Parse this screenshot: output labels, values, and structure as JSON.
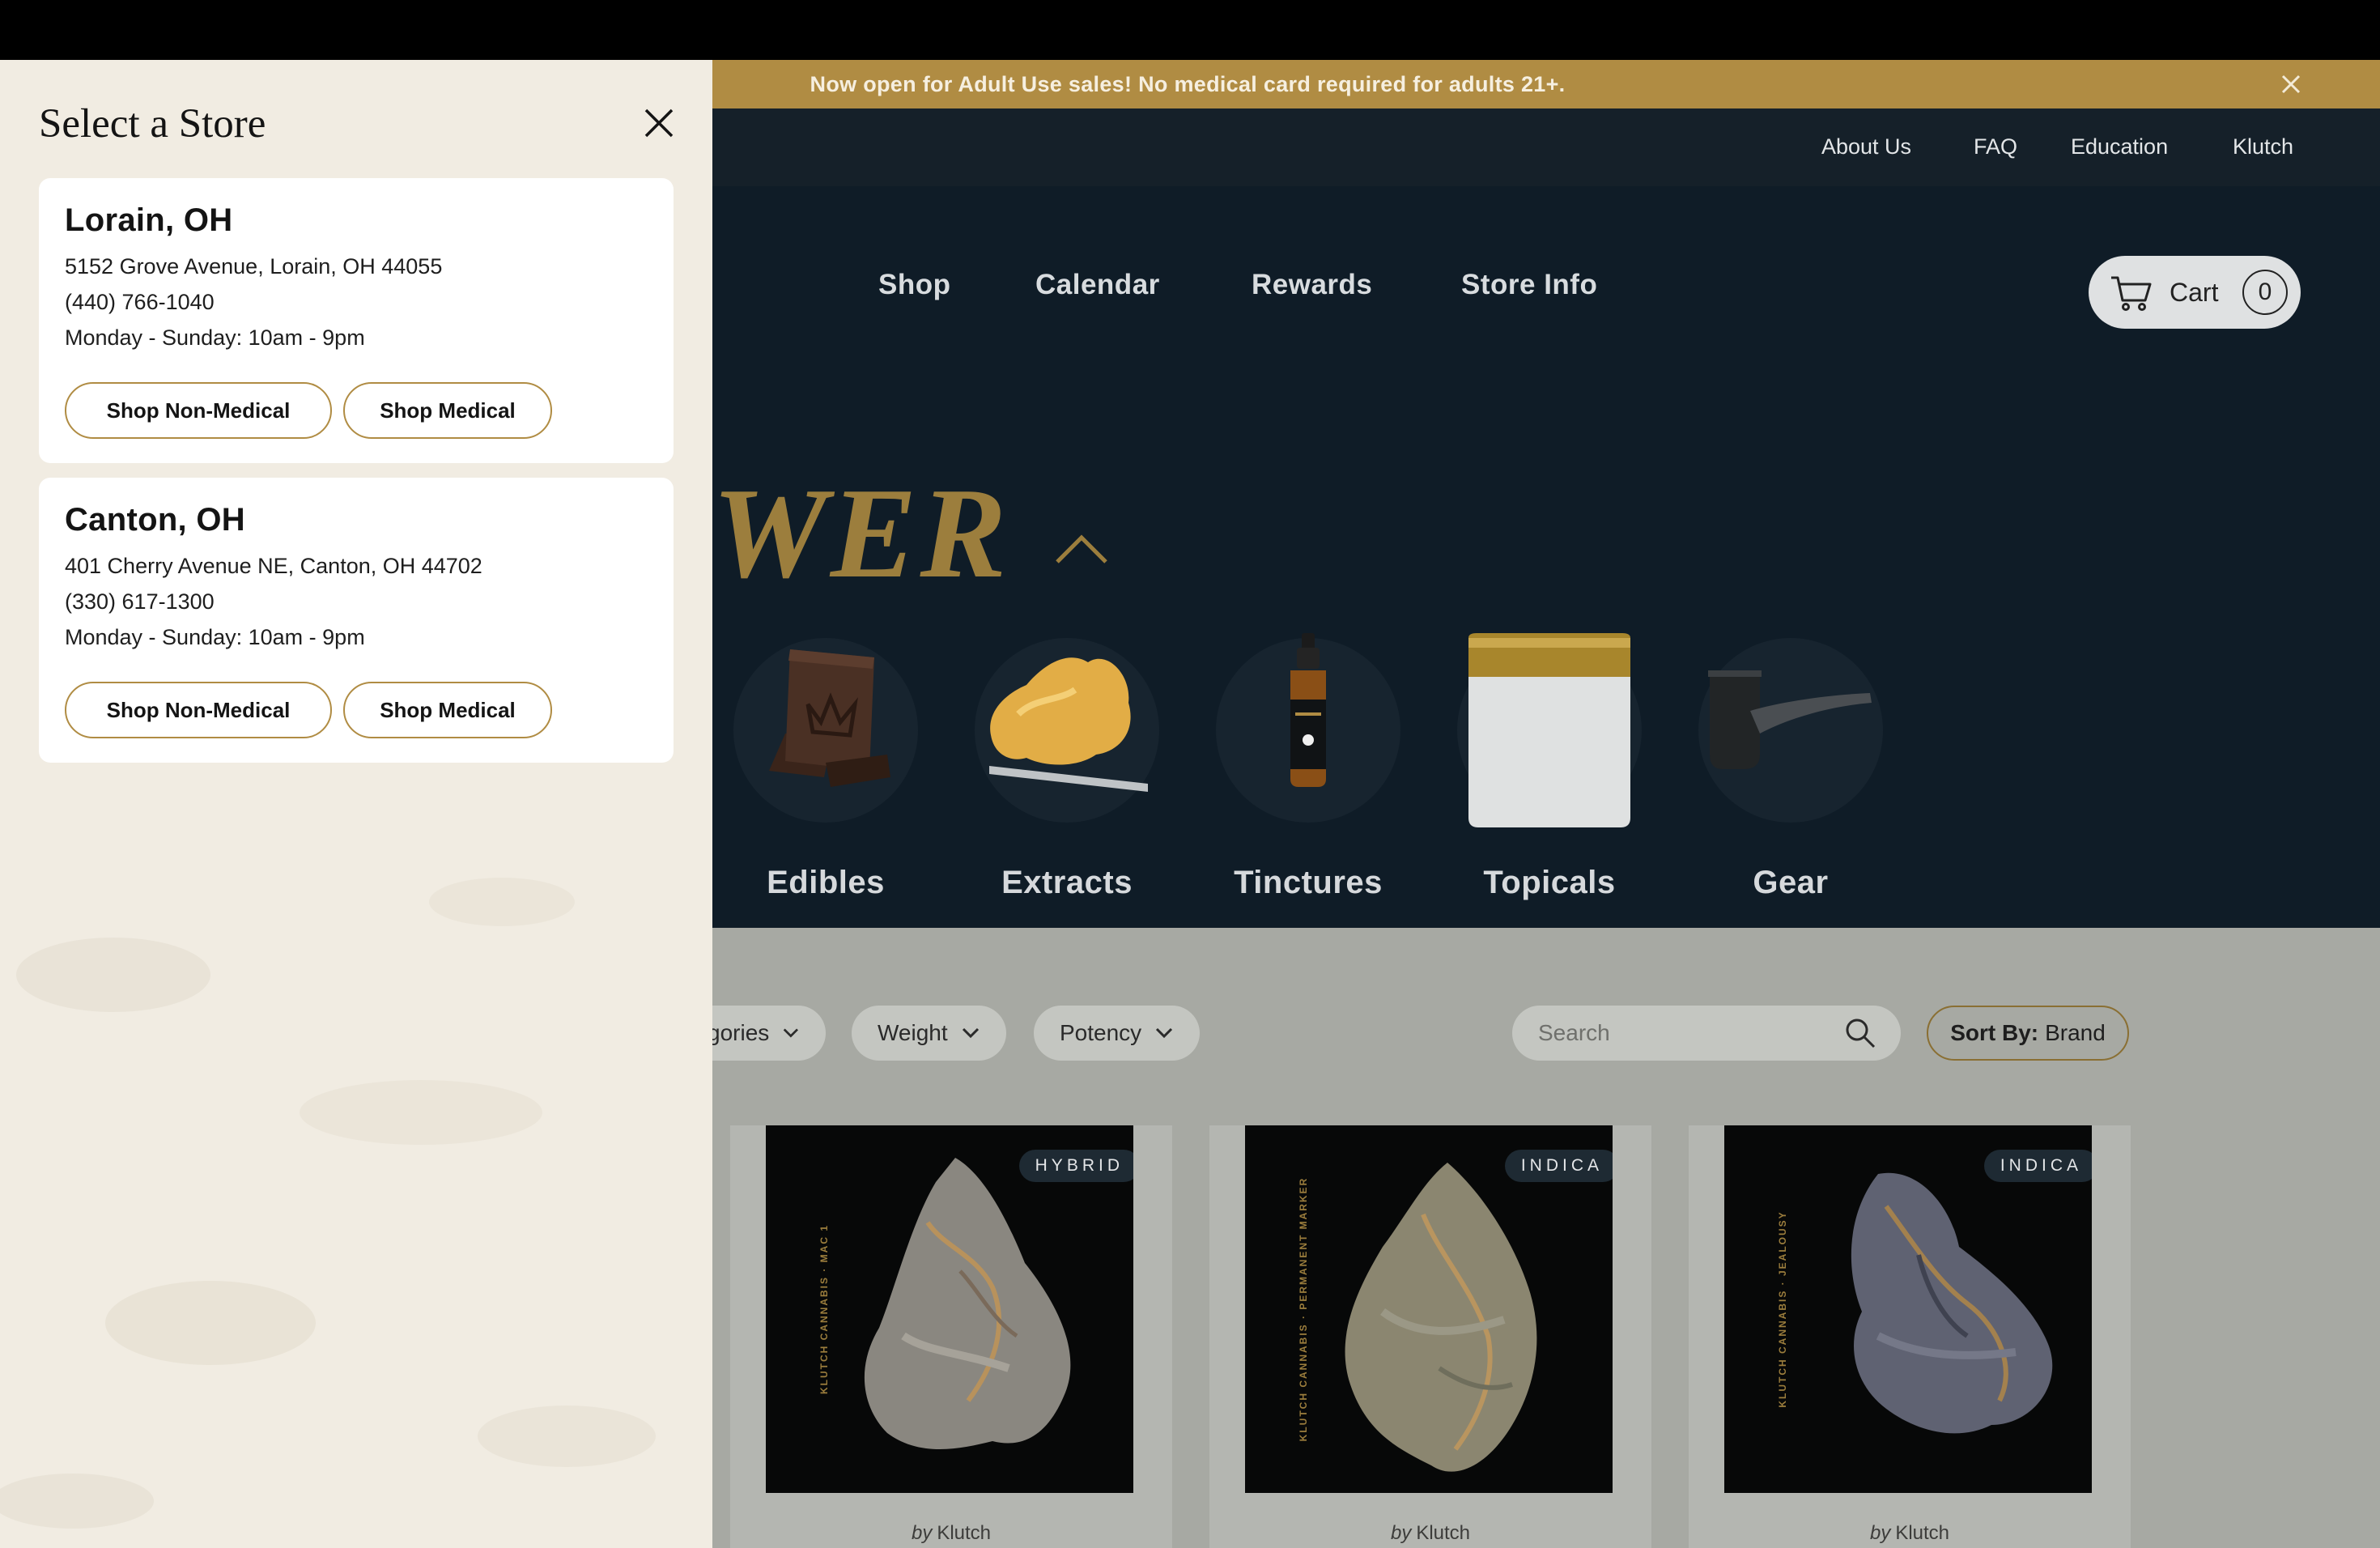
{
  "announcement": {
    "text": "Now open for Adult Use sales! No medical card required for adults 21+.",
    "close_icon": "close-icon"
  },
  "utility_nav": [
    "About Us",
    "FAQ",
    "Education",
    "Klutch"
  ],
  "main_nav": [
    "Shop",
    "Calendar",
    "Rewards",
    "Store Info"
  ],
  "cart": {
    "label": "Cart",
    "count": "0",
    "icon": "cart-icon"
  },
  "hero": {
    "title_visible": "OWER"
  },
  "categories": [
    {
      "label": "Edibles",
      "icon": "chocolate-bar-image"
    },
    {
      "label": "Extracts",
      "icon": "extract-nugget-image"
    },
    {
      "label": "Tinctures",
      "icon": "tincture-bottle-image"
    },
    {
      "label": "Topicals",
      "icon": "topical-jar-image"
    },
    {
      "label": "Gear",
      "icon": "pipe-image"
    }
  ],
  "filters": {
    "categories_label": "gories",
    "weight_label": "Weight",
    "potency_label": "Potency",
    "search_placeholder": "Search",
    "sort_prefix": "Sort By:",
    "sort_value": "Brand"
  },
  "products": [
    {
      "badge": "HYBRID",
      "spine": "KLUTCH CANNABIS · MAC 1",
      "by": "by",
      "brand": "Klutch"
    },
    {
      "badge": "INDICA",
      "spine": "KLUTCH CANNABIS · PERMANENT MARKER",
      "by": "by",
      "brand": "Klutch"
    },
    {
      "badge": "INDICA",
      "spine": "KLUTCH CANNABIS · JEALOUSY",
      "by": "by",
      "brand": "Klutch"
    }
  ],
  "drawer": {
    "title": "Select a Store",
    "stores": [
      {
        "name": "Lorain, OH",
        "address": "5152 Grove Avenue, Lorain, OH 44055",
        "phone": "(440) 766-1040",
        "hours": "Monday - Sunday: 10am - 9pm",
        "btn_non_medical": "Shop Non-Medical",
        "btn_medical": "Shop Medical"
      },
      {
        "name": "Canton, OH",
        "address": "401 Cherry Avenue NE, Canton, OH 44702",
        "phone": "(330) 617-1300",
        "hours": "Monday - Sunday: 10am - 9pm",
        "btn_non_medical": "Shop Non-Medical",
        "btn_medical": "Shop Medical"
      }
    ]
  },
  "colors": {
    "gold": "#b08c43",
    "navy": "#0f1c27",
    "drawer_bg": "#f1ece2"
  }
}
